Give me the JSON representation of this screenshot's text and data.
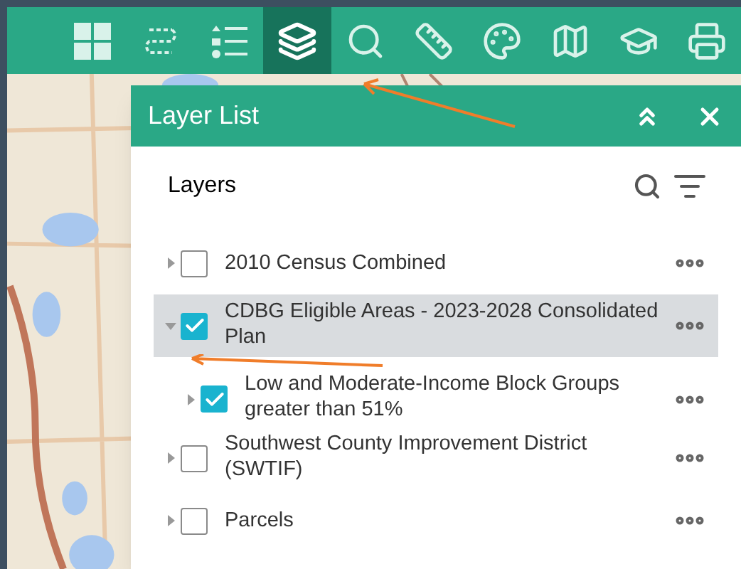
{
  "toolbar": [
    {
      "kind": "grid",
      "selected": false
    },
    {
      "kind": "route",
      "selected": false
    },
    {
      "kind": "legend",
      "selected": false
    },
    {
      "kind": "layers",
      "selected": true
    },
    {
      "kind": "search",
      "selected": false
    },
    {
      "kind": "ruler",
      "selected": false
    },
    {
      "kind": "palette",
      "selected": false
    },
    {
      "kind": "map",
      "selected": false
    },
    {
      "kind": "cap",
      "selected": false
    },
    {
      "kind": "print",
      "selected": false
    }
  ],
  "panel": {
    "title": "Layer List",
    "heading": "Layers",
    "layers": [
      {
        "label": "2010 Census Combined",
        "checked": false,
        "expanded": false,
        "selected": false
      },
      {
        "label": "CDBG Eligible Areas - 2023-2028 Consolidated Plan",
        "checked": true,
        "expanded": true,
        "selected": true,
        "children": [
          {
            "label": "Low and Moderate-Income Block Groups greater than 51%",
            "checked": true,
            "expanded": false,
            "selected": false
          }
        ]
      },
      {
        "label": "Southwest County Improvement District (SWTIF)",
        "checked": false,
        "expanded": false,
        "selected": false
      },
      {
        "label": "Parcels",
        "checked": false,
        "expanded": false,
        "selected": false
      }
    ]
  }
}
